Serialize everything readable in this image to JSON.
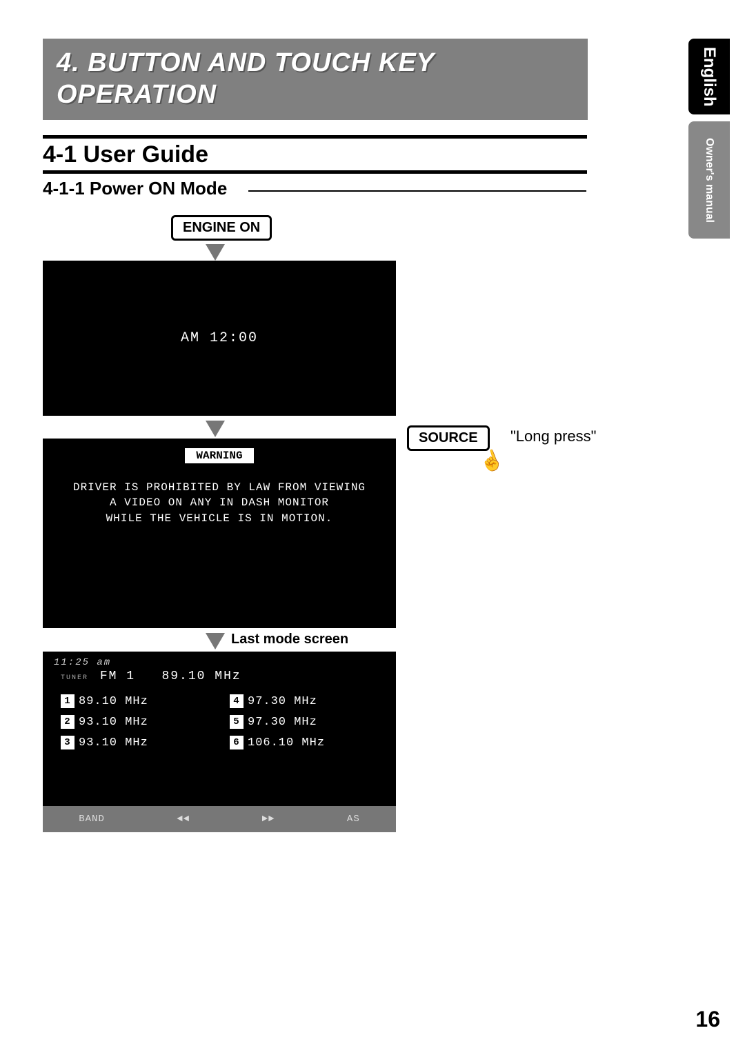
{
  "banner": {
    "line1": "4. BUTTON AND TOUCH KEY",
    "line2": "OPERATION"
  },
  "tabs": {
    "english": "English",
    "owners": "Owner's manual"
  },
  "headings": {
    "user_guide": "4-1 User Guide",
    "power_on": "4-1-1 Power ON Mode"
  },
  "labels": {
    "engine_on": "ENGINE ON",
    "source": "SOURCE",
    "long_press": "\"Long press\"",
    "last_mode": "Last mode screen",
    "warning": "WARNING"
  },
  "screen1": {
    "clock": "AM 12:00"
  },
  "screen2": {
    "warning_l1": "DRIVER IS PROHIBITED BY LAW FROM VIEWING",
    "warning_l2": "A VIDEO ON ANY IN DASH MONITOR",
    "warning_l3": "WHILE THE VEHICLE IS IN MOTION."
  },
  "screen3": {
    "time": "11:25 am",
    "tuner_label": "TUNER",
    "band": "FM 1",
    "current_freq": "89.10 MHz",
    "presets": [
      {
        "n": "1",
        "f": "89.10 MHz"
      },
      {
        "n": "4",
        "f": "97.30 MHz"
      },
      {
        "n": "2",
        "f": "93.10 MHz"
      },
      {
        "n": "5",
        "f": "97.30 MHz"
      },
      {
        "n": "3",
        "f": "93.10 MHz"
      },
      {
        "n": "6",
        "f": "106.10 MHz"
      }
    ],
    "bar": {
      "band": "BAND",
      "prev": "◄◄",
      "next": "►►",
      "as": "AS"
    }
  },
  "page_number": "16"
}
